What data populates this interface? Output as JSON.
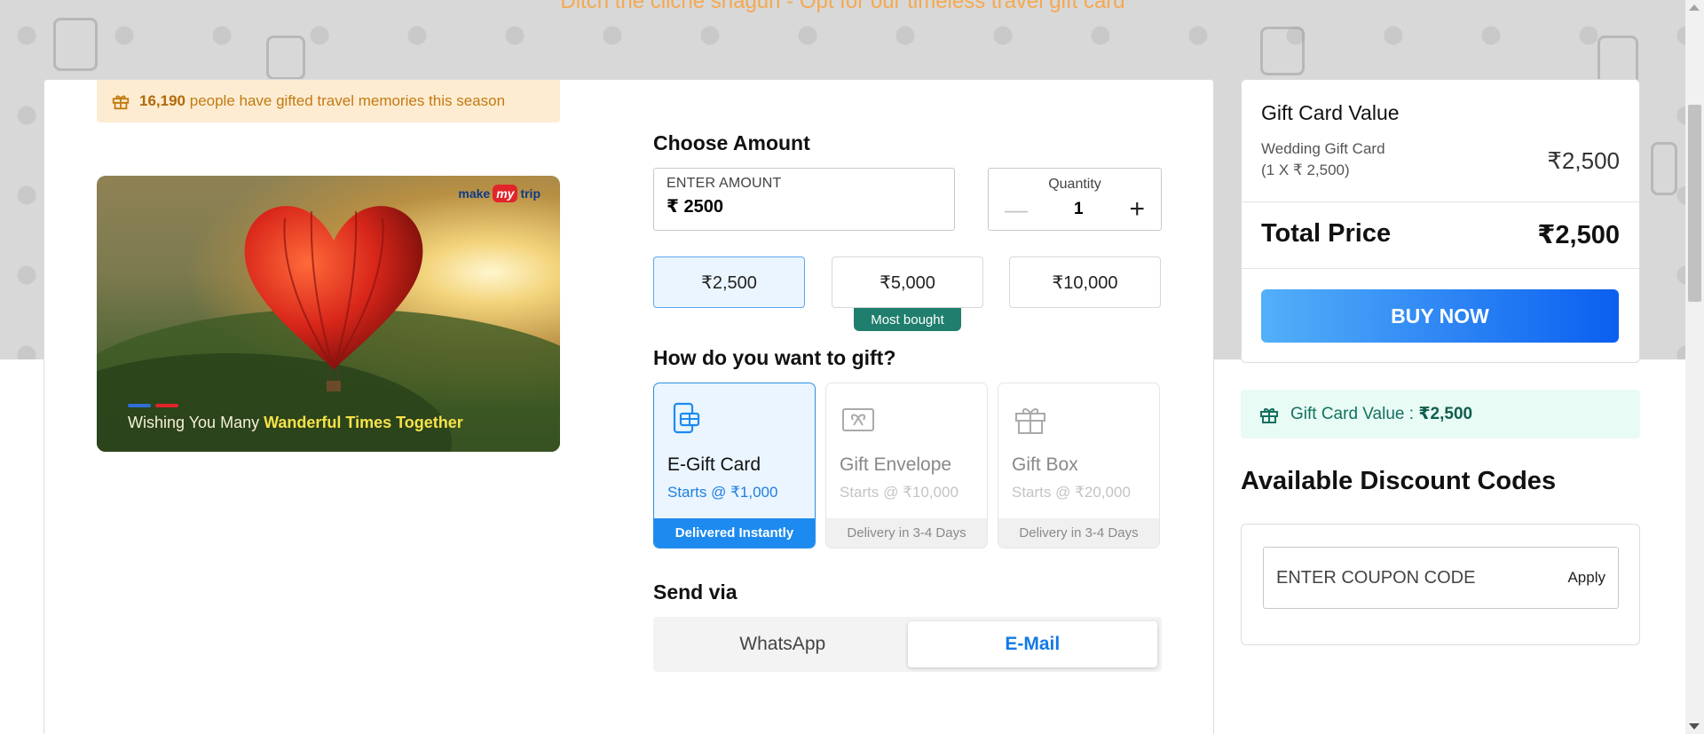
{
  "hero": {
    "tagline": "Ditch the cliché shagun - Opt for our timeless travel gift card"
  },
  "stat": {
    "count": "16,190",
    "text": "people have gifted travel memories this season"
  },
  "card_image": {
    "brand_prefix": "make",
    "brand_my": "my",
    "brand_suffix": "trip",
    "caption_normal": "Wishing You Many ",
    "caption_bold": "Wanderful Times Together"
  },
  "amount": {
    "title": "Choose Amount",
    "label": "ENTER AMOUNT",
    "currency": "₹",
    "value": "2500",
    "options": [
      "₹2,500",
      "₹5,000",
      "₹10,000"
    ],
    "selected_index": 0,
    "most_bought": "Most bought"
  },
  "quantity": {
    "label": "Quantity",
    "minus": "—",
    "value": "1",
    "plus": "+"
  },
  "gift_type": {
    "title": "How do you want to gift?",
    "options": [
      {
        "name": "E-Gift Card",
        "price": "Starts @ ₹1,000",
        "footer": "Delivered Instantly",
        "icon": "e-gift-card-icon",
        "selected": true
      },
      {
        "name": "Gift Envelope",
        "price": "Starts @ ₹10,000",
        "footer": "Delivery in 3-4 Days",
        "icon": "gift-envelope-icon",
        "selected": false
      },
      {
        "name": "Gift Box",
        "price": "Starts @ ₹20,000",
        "footer": "Delivery in 3-4 Days",
        "icon": "gift-box-icon",
        "selected": false
      }
    ]
  },
  "send_via": {
    "title": "Send via",
    "tabs": [
      "WhatsApp",
      "E-Mail"
    ],
    "active": "E-Mail"
  },
  "summary": {
    "title": "Gift Card Value",
    "item_name": "Wedding Gift Card",
    "item_detail": "(1 X ₹ 2,500)",
    "item_value": "₹2,500",
    "total_label": "Total Price",
    "total_value": "₹2,500",
    "buy_label": "BUY NOW"
  },
  "value_strip": {
    "label": "Gift Card Value :",
    "value": "₹2,500"
  },
  "discounts": {
    "title": "Available Discount Codes",
    "placeholder": "ENTER COUPON CODE",
    "apply_label": "Apply"
  },
  "colors": {
    "accent_blue": "#1d8af0",
    "selected_bg": "#eaf5ff",
    "most_bought_green": "#1f7e6d",
    "banner_orange": "#c27a11"
  }
}
